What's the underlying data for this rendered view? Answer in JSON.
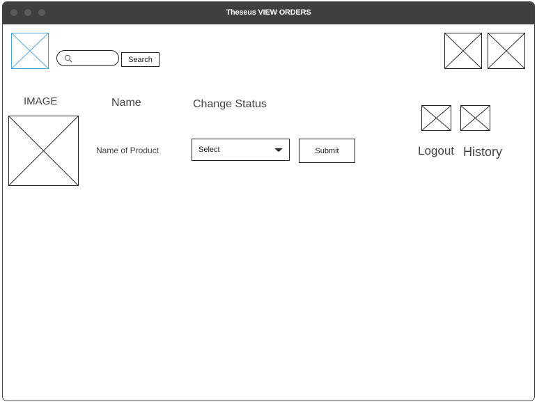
{
  "window": {
    "title": "Theseus VIEW ORDERS"
  },
  "header": {
    "search": {
      "placeholder": "",
      "button_label": "Search"
    }
  },
  "columns": {
    "image": "IMAGE",
    "name": "Name",
    "change_status": "Change Status"
  },
  "order_row": {
    "product_name": "Name of Product",
    "status_select_value": "Select",
    "submit_label": "Submit"
  },
  "side_links": {
    "logout": "Logout",
    "history": "History"
  },
  "colors": {
    "titlebar": "#3f3f3f",
    "logo_placeholder": "#4aa3d8"
  }
}
